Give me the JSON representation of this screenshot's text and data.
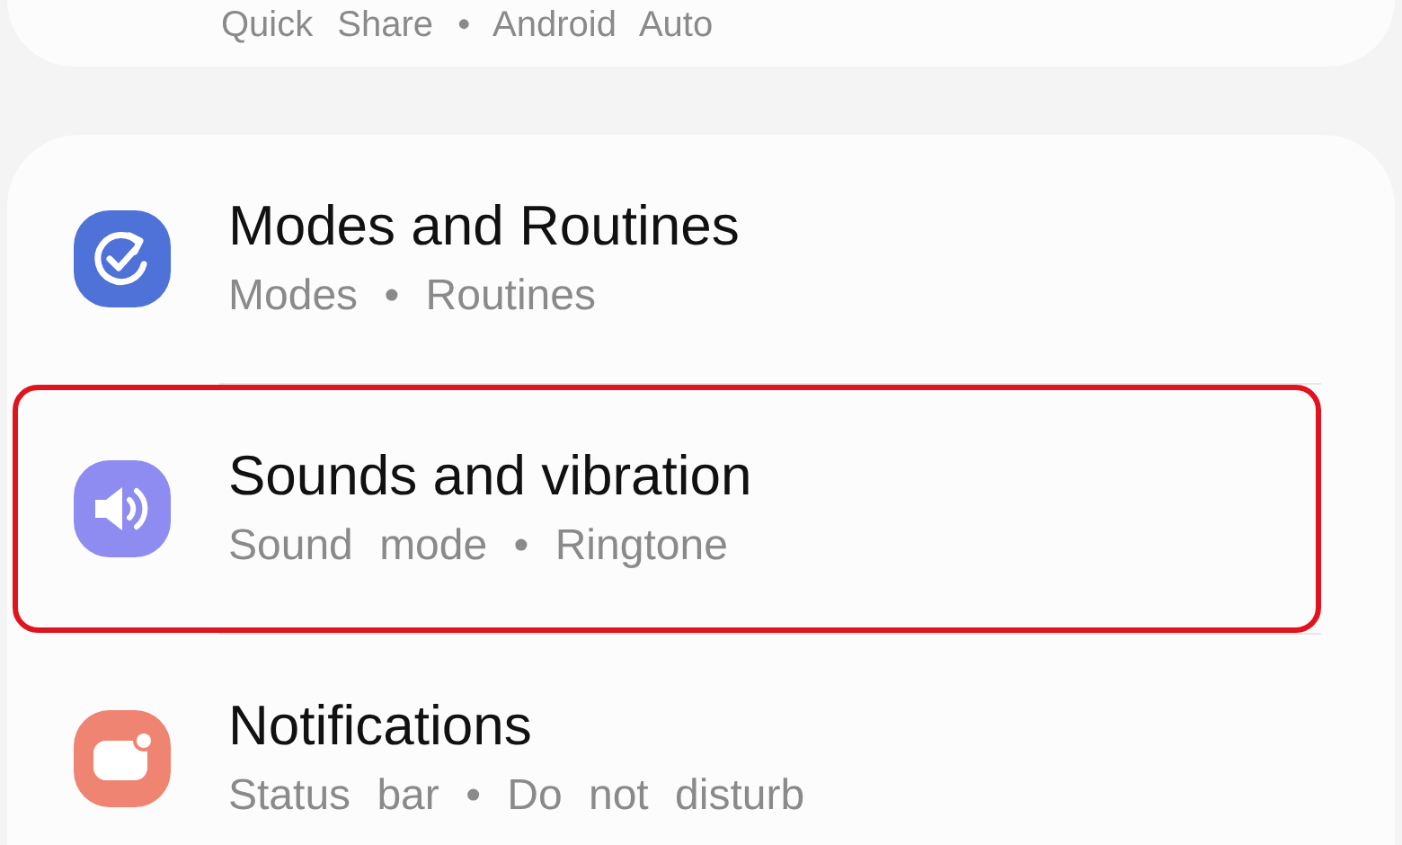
{
  "top_card": {
    "subtitle": "Quick Share • Android Auto"
  },
  "items": [
    {
      "kind": "routines",
      "title": "Modes and Routines",
      "subtitle": "Modes • Routines",
      "selected": false
    },
    {
      "kind": "sound",
      "title": "Sounds and vibration",
      "subtitle": "Sound mode • Ringtone",
      "selected": true
    },
    {
      "kind": "notifications",
      "title": "Notifications",
      "subtitle": "Status bar • Do not disturb",
      "selected": false
    }
  ]
}
